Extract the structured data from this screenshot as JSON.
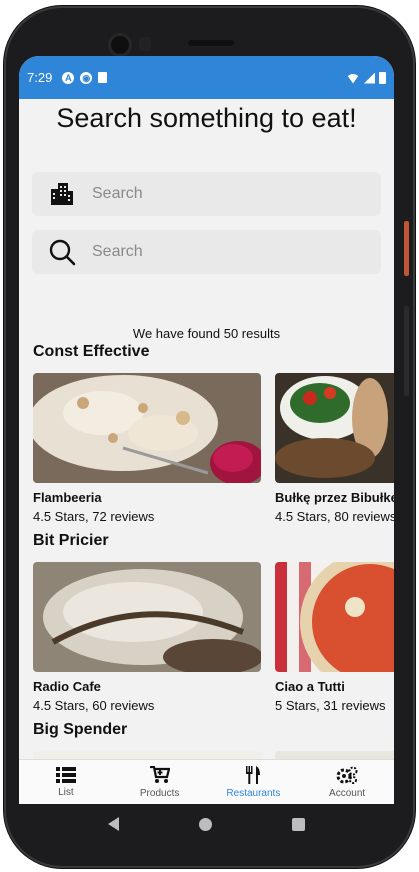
{
  "status_bar": {
    "time": "7:29",
    "icon_a": "A"
  },
  "header": {
    "title": "Search something to eat!"
  },
  "search": {
    "city_placeholder": "Search",
    "query_placeholder": "Search"
  },
  "results_text": "We have found 50 results",
  "sections": [
    {
      "title": "Const Effective",
      "cards": [
        {
          "name": "Flambeeria",
          "meta": "4.5 Stars, 72 reviews"
        },
        {
          "name": "Bułkę przez Bibułkę",
          "meta": "4.5 Stars, 80 reviews"
        }
      ]
    },
    {
      "title": "Bit Pricier",
      "cards": [
        {
          "name": "Radio Cafe",
          "meta": "4.5 Stars, 60 reviews"
        },
        {
          "name": "Ciao a Tutti",
          "meta": "5 Stars, 31 reviews"
        }
      ]
    },
    {
      "title": "Big Spender",
      "cards": [
        {
          "name": "",
          "meta": ""
        },
        {
          "name": "",
          "meta": ""
        }
      ]
    }
  ],
  "nav": [
    {
      "label": "List",
      "icon": "list-icon",
      "active": false
    },
    {
      "label": "Products",
      "icon": "cart-icon",
      "active": false
    },
    {
      "label": "Restaurants",
      "icon": "utensils-icon",
      "active": true
    },
    {
      "label": "Account",
      "icon": "gears-icon",
      "active": false
    }
  ],
  "colors": {
    "accent": "#2f86d8",
    "background": "#f2f2f2"
  }
}
